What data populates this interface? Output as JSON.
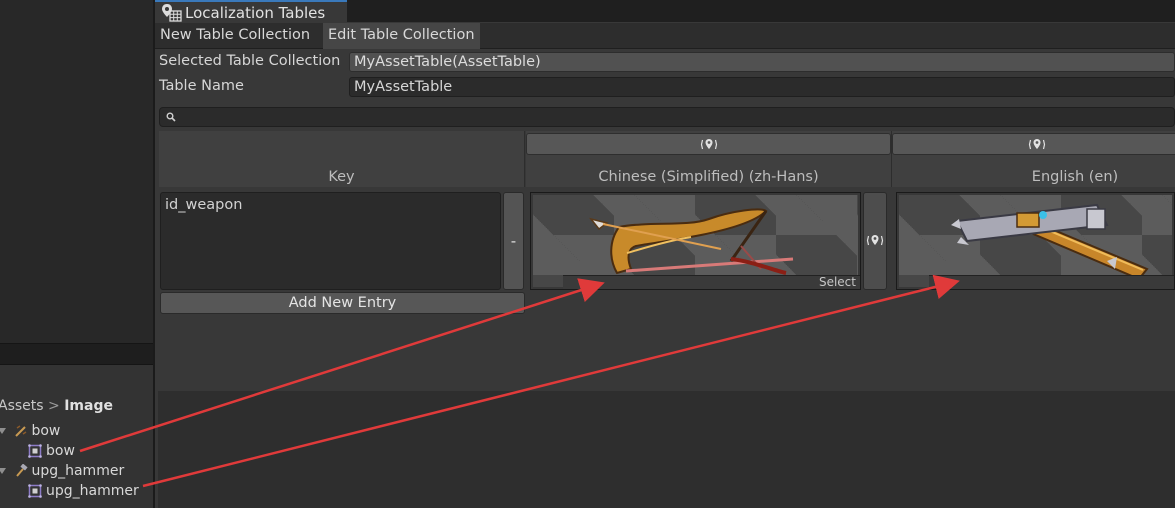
{
  "project": {
    "breadcrumb": {
      "parent": "Assets",
      "current": "Image"
    },
    "tree": [
      {
        "label": "bow",
        "icon": "texture-icon"
      },
      {
        "label": "bow",
        "icon": "sprite-icon"
      },
      {
        "label": "upg_hammer",
        "icon": "texture-icon"
      },
      {
        "label": "upg_hammer",
        "icon": "sprite-icon"
      }
    ]
  },
  "window": {
    "tab_title": "Localization Tables",
    "toolbar": {
      "new": "New Table Collection",
      "edit": "Edit Table Collection"
    },
    "fields": {
      "collection_label": "Selected Table Collection",
      "collection_value": "MyAssetTable(AssetTable)",
      "name_label": "Table Name",
      "name_value": "MyAssetTable"
    },
    "table": {
      "key_header": "Key",
      "columns": [
        "Chinese (Simplified) (zh-Hans)",
        "English (en)"
      ],
      "rows": [
        {
          "key": "id_weapon",
          "remove_label": "-",
          "select_label": "Select"
        }
      ],
      "add_entry": "Add New Entry"
    }
  },
  "colors": {
    "accent_tab": "#3a79bb",
    "arrow": "#e03a3a"
  }
}
